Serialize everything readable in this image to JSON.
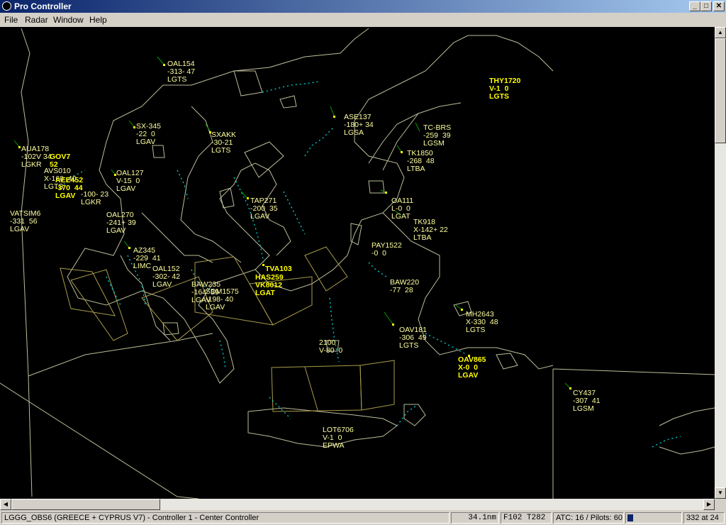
{
  "window": {
    "title": "Pro Controller",
    "controls": {
      "minimize": "_",
      "maximize": "□",
      "close": "✕"
    }
  },
  "menu": [
    {
      "label": "File"
    },
    {
      "label": "Radar"
    },
    {
      "label": "Window"
    },
    {
      "label": "Help"
    }
  ],
  "colors": {
    "background": "#000000",
    "map_lines": "#bdbd9a",
    "airspace": "#a89c4a",
    "history_trail": "#00c8c8",
    "data_block": "#ffffa0",
    "data_block_overlap": "#ffff00",
    "leader_line": "#00a000"
  },
  "aircraft": [
    {
      "id": "oal154",
      "lines": [
        "OAL154",
        "-313- 47",
        "LGTS"
      ]
    },
    {
      "id": "sx345",
      "lines": [
        "SX-345",
        "-22  0",
        "LGAV"
      ]
    },
    {
      "id": "sxakk",
      "lines": [
        "SXAKK",
        "-30-21",
        "LGTS"
      ]
    },
    {
      "id": "ase137",
      "lines": [
        "ASE137",
        "-180+ 34",
        "LGSA"
      ]
    },
    {
      "id": "tk1720",
      "lines": [
        "THY1720",
        "V-1  0",
        "LGTS"
      ],
      "overlap": true
    },
    {
      "id": "tcbrs",
      "lines": [
        "TC-BRS",
        "-259  39",
        "LGSM"
      ]
    },
    {
      "id": "tk1850",
      "lines": [
        "TK1850",
        "-268  48",
        "LTBA"
      ]
    },
    {
      "id": "aua178",
      "lines": [
        "AUA178",
        "-102V 34",
        "LGKR"
      ],
      "overlap": true
    },
    {
      "id": "gov7",
      "lines": [
        "GOV7",
        "52",
        ""
      ],
      "overlap": true
    },
    {
      "id": "avs010",
      "lines": [
        "AVS010",
        "X-160  40",
        "LGTS"
      ],
      "overlap": true
    },
    {
      "id": "oal127",
      "lines": [
        "OAL127",
        "V-15  0",
        "LGAV"
      ]
    },
    {
      "id": "cluster_w",
      "lines": [
        "AEE452",
        "-370  44",
        "LGAV"
      ],
      "overlap": true
    },
    {
      "id": "lgkr",
      "lines": [
        "",
        "-100- 23",
        "LGKR"
      ],
      "overlap": true
    },
    {
      "id": "tap271",
      "lines": [
        "TAP271",
        "-200  35",
        "LGAV"
      ]
    },
    {
      "id": "oa111",
      "lines": [
        "OA111",
        "L-0  0",
        "LGAT"
      ]
    },
    {
      "id": "vatsim6",
      "lines": [
        "VATSIM6",
        "-331  56",
        "LGAV"
      ]
    },
    {
      "id": "oal270",
      "lines": [
        "OAL270",
        "-241+ 39",
        "LGAV"
      ]
    },
    {
      "id": "tk918",
      "lines": [
        "TK918",
        "X-142+ 22",
        "LTBA"
      ]
    },
    {
      "id": "pay1522",
      "lines": [
        "PAY1522",
        "-0  0",
        ""
      ]
    },
    {
      "id": "az345",
      "lines": [
        "AZ345",
        "-229  41",
        "LIMC"
      ]
    },
    {
      "id": "oal152",
      "lines": [
        "OAL152",
        "-302- 42",
        "LGAV"
      ]
    },
    {
      "id": "tva103",
      "lines": [
        "TVA103",
        "",
        ""
      ],
      "overlap": true
    },
    {
      "id": "athens_cluster",
      "lines": [
        "HAS259",
        "VK8012",
        "LGAT"
      ],
      "overlap": true
    },
    {
      "id": "baw235",
      "lines": [
        "BAW235",
        "-164  39",
        "LGAV"
      ]
    },
    {
      "id": "sdm1575",
      "lines": [
        "SDM1575",
        "-198- 40",
        "LGAV"
      ]
    },
    {
      "id": "baw220",
      "lines": [
        "BAW220",
        "-77  28",
        ""
      ]
    },
    {
      "id": "mh2643",
      "lines": [
        "MH2643",
        "X-330  48",
        "LGTS"
      ]
    },
    {
      "id": "oav181",
      "lines": [
        "OAV181",
        "-306  49",
        "LGTS"
      ]
    },
    {
      "id": "c2100",
      "lines": [
        "2100",
        "V-80  0",
        ""
      ]
    },
    {
      "id": "rhodes_cluster",
      "lines": [
        "OAV865",
        "X-0  0",
        "LGAV"
      ],
      "overlap": true
    },
    {
      "id": "cy437",
      "lines": [
        "CY437",
        "-307  41",
        "LGSM"
      ]
    },
    {
      "id": "lot6706",
      "lines": [
        "LOT6706",
        "V-1  0",
        "EPWA"
      ]
    }
  ],
  "status": {
    "session": "LGGG_OBS6 (GREECE + CYPRUS V7) - Controller 1 - Center Controller",
    "distance": "34.1nm",
    "levels": "F102 T282",
    "counts": "ATC: 16 / Pilots: 60",
    "cursor": "332 at 24"
  }
}
